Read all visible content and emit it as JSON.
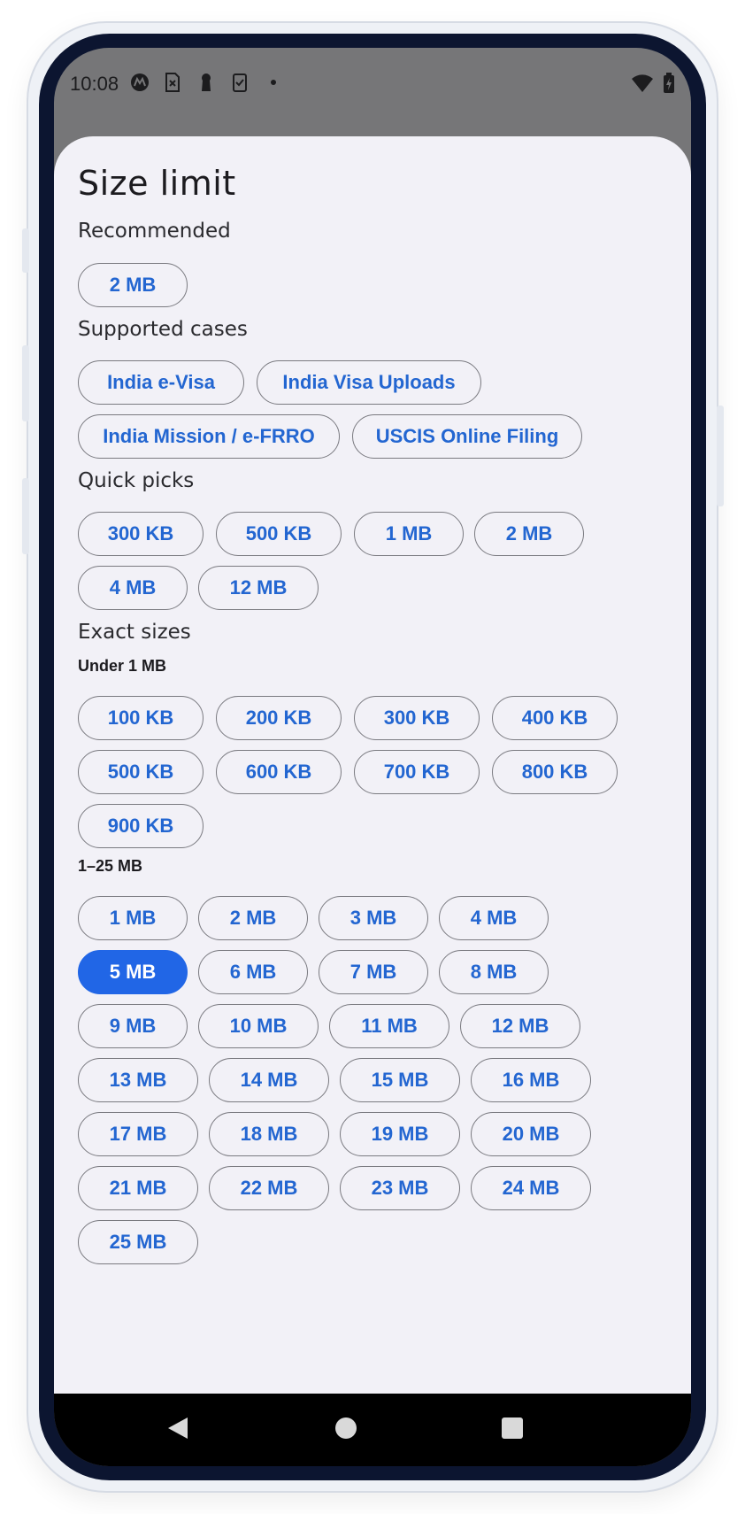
{
  "status_bar": {
    "time": "10:08",
    "icons": [
      "motorola-icon",
      "sim-off-icon",
      "keyhole-icon",
      "clipboard-icon",
      "dot-icon"
    ],
    "right_icons": [
      "wifi-icon",
      "battery-charging-icon"
    ]
  },
  "sheet": {
    "title": "Size limit",
    "recommended": {
      "label": "Recommended",
      "chips": [
        "2 MB"
      ]
    },
    "supported": {
      "label": "Supported cases",
      "chips": [
        "India e-Visa",
        "India Visa Uploads",
        "India Mission / e-FRRO",
        "USCIS Online Filing"
      ]
    },
    "quick": {
      "label": "Quick picks",
      "chips": [
        "300 KB",
        "500 KB",
        "1 MB",
        "2 MB",
        "4 MB",
        "12 MB"
      ]
    },
    "exact": {
      "label": "Exact sizes",
      "under1": {
        "label": "Under 1 MB",
        "chips": [
          "100 KB",
          "200 KB",
          "300 KB",
          "400 KB",
          "500 KB",
          "600 KB",
          "700 KB",
          "800 KB",
          "900 KB"
        ]
      },
      "range": {
        "label": "1–25 MB",
        "chips": [
          "1 MB",
          "2 MB",
          "3 MB",
          "4 MB",
          "5 MB",
          "6 MB",
          "7 MB",
          "8 MB",
          "9 MB",
          "10 MB",
          "11 MB",
          "12 MB",
          "13 MB",
          "14 MB",
          "15 MB",
          "16 MB",
          "17 MB",
          "18 MB",
          "19 MB",
          "20 MB",
          "21 MB",
          "22 MB",
          "23 MB",
          "24 MB",
          "25 MB"
        ],
        "selected": "5 MB"
      }
    }
  },
  "nav": {
    "buttons": [
      "back-icon",
      "home-icon",
      "recents-icon"
    ]
  },
  "colors": {
    "accent": "#2166e6",
    "chip_text": "#2366d1",
    "sheet_bg": "#f2f1f7",
    "scrim": "#767678"
  }
}
